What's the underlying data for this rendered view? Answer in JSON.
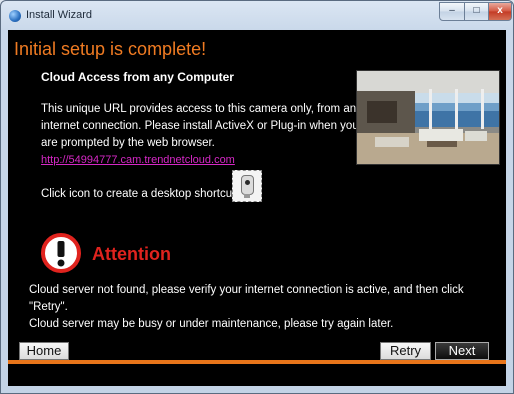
{
  "window": {
    "title": "Install Wizard",
    "controls": {
      "minimize": "–",
      "maximize": "□",
      "close": "x"
    }
  },
  "header": {
    "title": "Initial setup is complete!"
  },
  "cloud": {
    "heading": "Cloud Access from any Computer",
    "description": "This unique URL provides access to this camera only, from any internet connection. Please install ActiveX or Plug-in when you are prompted by the web browser.",
    "url": "http://54994777.cam.trendnetcloud.com",
    "shortcut_text": "Click icon to create a desktop shortcut."
  },
  "attention": {
    "label": "Attention",
    "message_line1": "Cloud server not found, please verify your internet connection is active, and then click \"Retry\".",
    "message_line2": "Cloud server may be busy or under maintenance, please try again later."
  },
  "buttons": {
    "home": "Home",
    "retry": "Retry",
    "next": "Next"
  },
  "colors": {
    "accent": "#f07b22",
    "attention": "#e0231e",
    "link": "#d628c6",
    "background": "#000000"
  },
  "icons": [
    "app-icon",
    "camera-icon",
    "attention-icon",
    "room-photo"
  ]
}
